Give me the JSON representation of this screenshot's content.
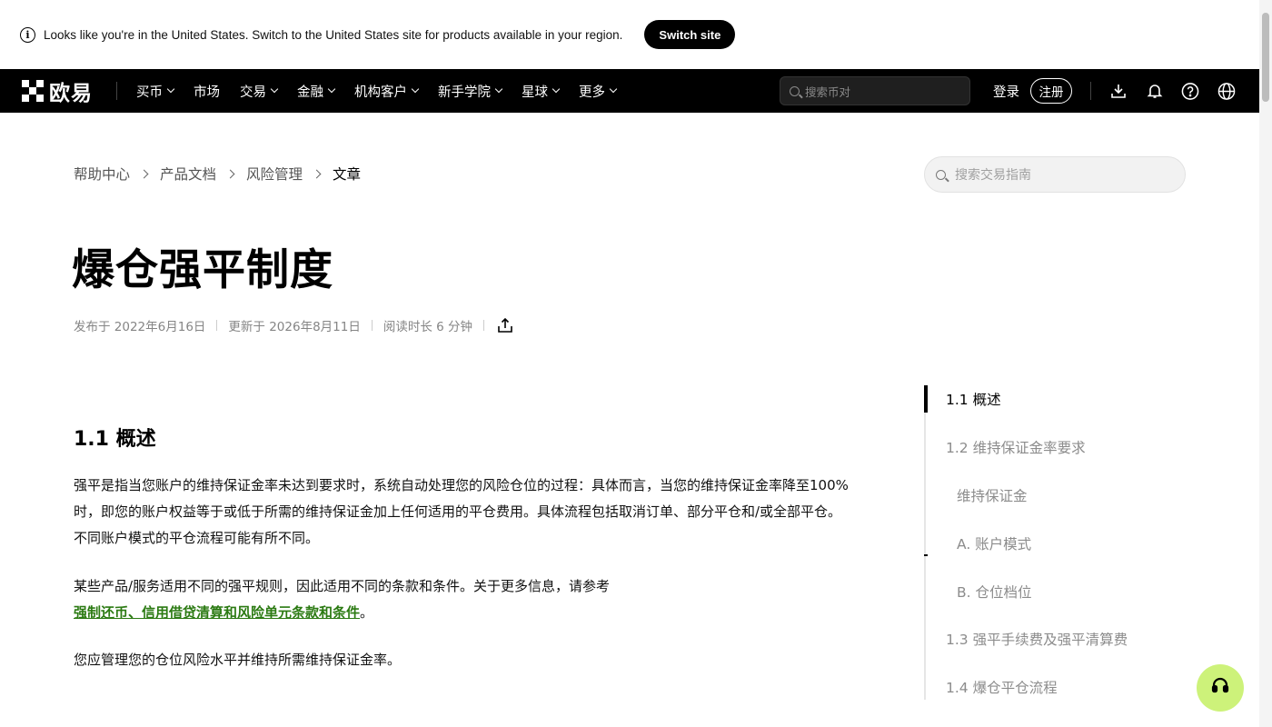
{
  "banner": {
    "message": "Looks like you're in the United States. Switch to the United States site for products available in your region.",
    "switch_label": "Switch site"
  },
  "nav": {
    "logo_text": "欧易",
    "items": [
      {
        "label": "买币",
        "dropdown": true
      },
      {
        "label": "市场",
        "dropdown": false
      },
      {
        "label": "交易",
        "dropdown": true
      },
      {
        "label": "金融",
        "dropdown": true
      },
      {
        "label": "机构客户",
        "dropdown": true
      },
      {
        "label": "新手学院",
        "dropdown": true
      },
      {
        "label": "星球",
        "dropdown": true
      },
      {
        "label": "更多",
        "dropdown": true
      }
    ],
    "search_placeholder": "搜索币对",
    "login_label": "登录",
    "register_label": "注册",
    "icons": [
      "download-icon",
      "bell-icon",
      "help-icon",
      "globe-icon"
    ]
  },
  "breadcrumb": {
    "items": [
      "帮助中心",
      "产品文档",
      "风险管理"
    ],
    "current": "文章"
  },
  "guide_search": {
    "placeholder": "搜索交易指南"
  },
  "article": {
    "title": "爆仓强平制度",
    "published": "发布于 2022年6月16日",
    "updated": "更新于 2026年8月11日",
    "read_time": "阅读时长 6 分钟",
    "section_heading": "1.1 概述",
    "para1_line1": "强平是指当您账户的维持保证金率未达到要求时，系统自动处理您的风险仓位的过程：具体而言，当您的维持保证金率降至100%",
    "para1_line2": "时，即您的账户权益等于或低于所需的维持保证金加上任何适用的平仓费用。具体流程包括取消订单、部分平仓和/或全部平仓。",
    "para1_line3": "不同账户模式的平仓流程可能有所不同。",
    "para2_text": "某些产品/服务适用不同的强平规则，因此适用不同的条款和条件。关于更多信息，请参考",
    "para2_link": "强制还币、信用借贷清算和风险单元条款和条件",
    "para2_end": "。",
    "para3": "您应管理您的仓位风险水平并维持所需维持保证金率。"
  },
  "toc": {
    "items": [
      {
        "label": "1.1 概述",
        "active": true
      },
      {
        "label": "1.2 维持保证金率要求",
        "active": false
      },
      {
        "label": "维持保证金",
        "active": false
      },
      {
        "label": "A. 账户模式",
        "active": false
      },
      {
        "label": "B. 仓位档位",
        "active": false
      },
      {
        "label": "1.3 强平手续费及强平清算费",
        "active": false
      },
      {
        "label": "1.4 爆仓平仓流程",
        "active": false
      }
    ]
  },
  "colors": {
    "accent_link": "#2b7a12",
    "support_fab": "#cdf27a",
    "nav_bg": "#000000"
  }
}
